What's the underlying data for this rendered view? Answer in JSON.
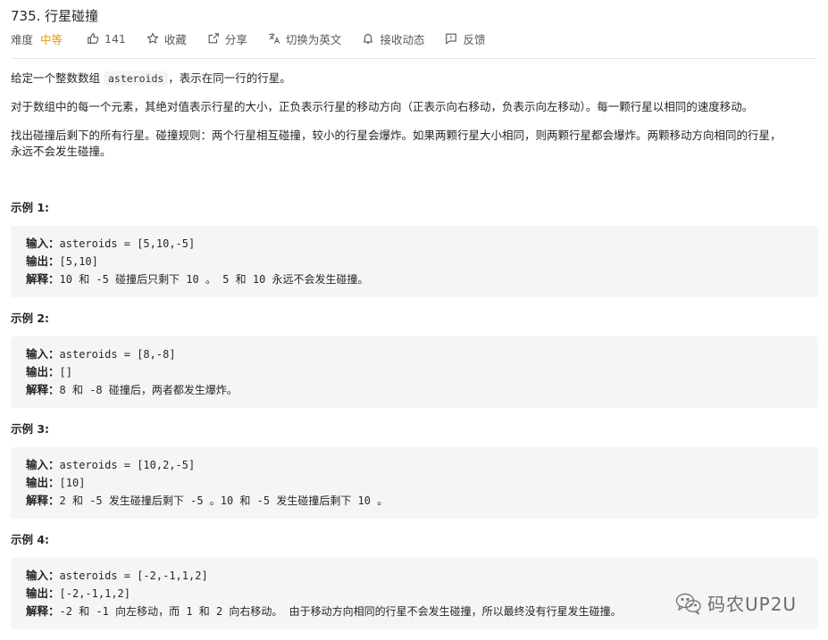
{
  "problem": {
    "title": "735. 行星碰撞",
    "difficulty_label": "难度",
    "difficulty_value": "中等",
    "likes": "141",
    "collect": "收藏",
    "share": "分享",
    "translate": "切换为英文",
    "notify": "接收动态",
    "feedback": "反馈"
  },
  "description": {
    "p1_pre": "给定一个整数数组 ",
    "p1_code": "asteroids",
    "p1_post": "，表示在同一行的行星。",
    "p2": "对于数组中的每一个元素，其绝对值表示行星的大小，正负表示行星的移动方向（正表示向右移动，负表示向左移动）。每一颗行星以相同的速度移动。",
    "p3_line1": "找出碰撞后剩下的所有行星。碰撞规则：两个行星相互碰撞，较小的行星会爆炸。如果两颗行星大小相同，则两颗行星都会爆炸。两颗移动方向相同的行星，",
    "p3_line2": "永远不会发生碰撞。"
  },
  "labels": {
    "input": "输入：",
    "output": "输出：",
    "explanation": "解释："
  },
  "examples": [
    {
      "title": "示例 1:",
      "input": "asteroids = [5,10,-5]",
      "output": "[5,10]",
      "explanation": "10 和 -5 碰撞后只剩下 10 。 5 和 10 永远不会发生碰撞。"
    },
    {
      "title": "示例 2:",
      "input": "asteroids = [8,-8]",
      "output": "[]",
      "explanation": "8 和 -8 碰撞后，两者都发生爆炸。"
    },
    {
      "title": "示例 3:",
      "input": "asteroids = [10,2,-5]",
      "output": "[10]",
      "explanation": "2 和 -5 发生碰撞后剩下 -5 。10 和 -5 发生碰撞后剩下 10 。"
    },
    {
      "title": "示例 4:",
      "input": "asteroids = [-2,-1,1,2]",
      "output": "[-2,-1,1,2]",
      "explanation": "-2 和 -1 向左移动，而 1 和 2 向右移动。 由于移动方向相同的行星不会发生碰撞，所以最终没有行星发生碰撞。"
    }
  ],
  "watermark": "码农UP2U",
  "colors": {
    "difficulty_medium": "#ef9b00",
    "example_bg": "#f5f5f5"
  }
}
